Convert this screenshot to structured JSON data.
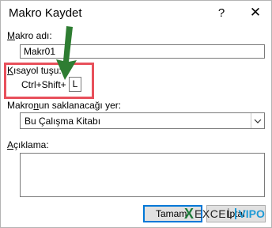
{
  "dialog": {
    "title": "Makro Kaydet",
    "help_glyph": "?",
    "close_glyph": "✕"
  },
  "macro_name": {
    "label_mnemonic": "M",
    "label_rest": "akro adı:",
    "value": "Makr01"
  },
  "shortcut": {
    "label_mnemonic": "K",
    "label_rest": "ısayol tuşu:",
    "prefix": "Ctrl+Shift+",
    "value": "L"
  },
  "store_in": {
    "label_before": "Makro",
    "label_mnemonic": "n",
    "label_after": "un saklanacağı yer:",
    "selected": "Bu Çalışma Kitabı"
  },
  "description": {
    "label_mnemonic": "A",
    "label_rest": "çıklama:",
    "value": ""
  },
  "buttons": {
    "ok": "Tamam",
    "cancel": "İptal"
  },
  "watermark": {
    "logo_mark": "X",
    "brand_part1": "EXCEL",
    "brand_part2": "VIPO"
  },
  "colors": {
    "highlight_border": "#e8505b",
    "arrow": "#2e7d32",
    "ok_focus": "#0078d7"
  }
}
